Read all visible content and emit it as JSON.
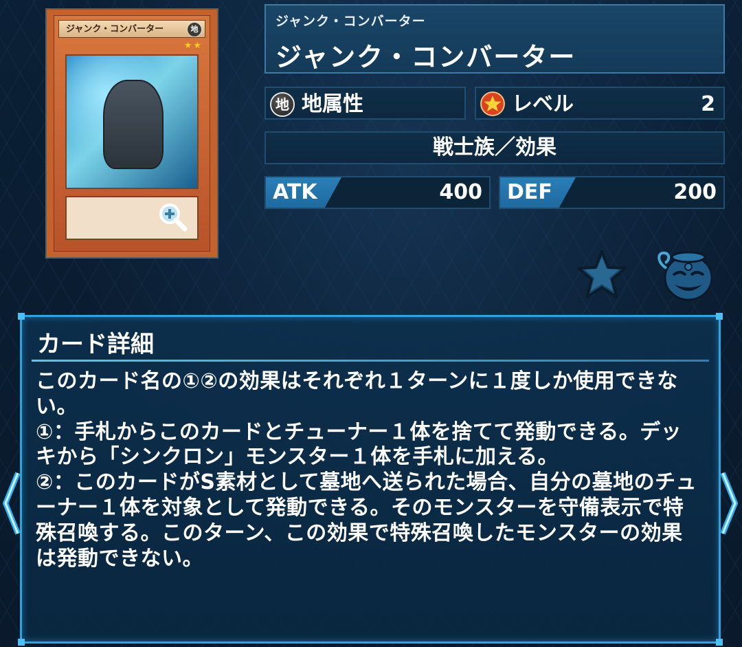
{
  "card": {
    "name_ruby": "ジャンク・コンバーター",
    "name": "ジャンク・コンバーター",
    "image_name_bar": "ジャンク・コンバーター",
    "image_attribute_glyph": "地",
    "image_level_stars": "★★",
    "attribute_glyph": "地",
    "attribute": "地属性",
    "level_label": "レベル",
    "level_value": "2",
    "type": "戦士族／効果",
    "atk_label": "ATK",
    "atk_value": "400",
    "def_label": "DEF",
    "def_value": "200"
  },
  "detail": {
    "title": "カード詳細",
    "text": "このカード名の①②の効果はそれぞれ１ターンに１度しか使用できない。\n①：手札からこのカードとチューナー１体を捨てて発動できる。デッキから「シンクロン」モンスター１体を手札に加える。\n②：このカードがS素材として墓地へ送られた場合、自分の墓地のチューナー１体を対象として発動できる。そのモンスターを守備表示で特殊召喚する。このターン、この効果で特殊召喚したモンスターの効果は発動できない。"
  },
  "icons": {
    "zoom": "zoom-in-icon",
    "attribute": "earth-attribute-icon",
    "level": "level-star-icon",
    "favorite": "star-icon",
    "mascot": "mascot-pot-icon",
    "prev": "chevron-left-icon",
    "next": "chevron-right-icon"
  },
  "colors": {
    "panel_border": "#2fa3dd",
    "stat_border": "#1f4e72",
    "atk_accent": "#2a7fb8",
    "card_frame": "#c4622f"
  }
}
